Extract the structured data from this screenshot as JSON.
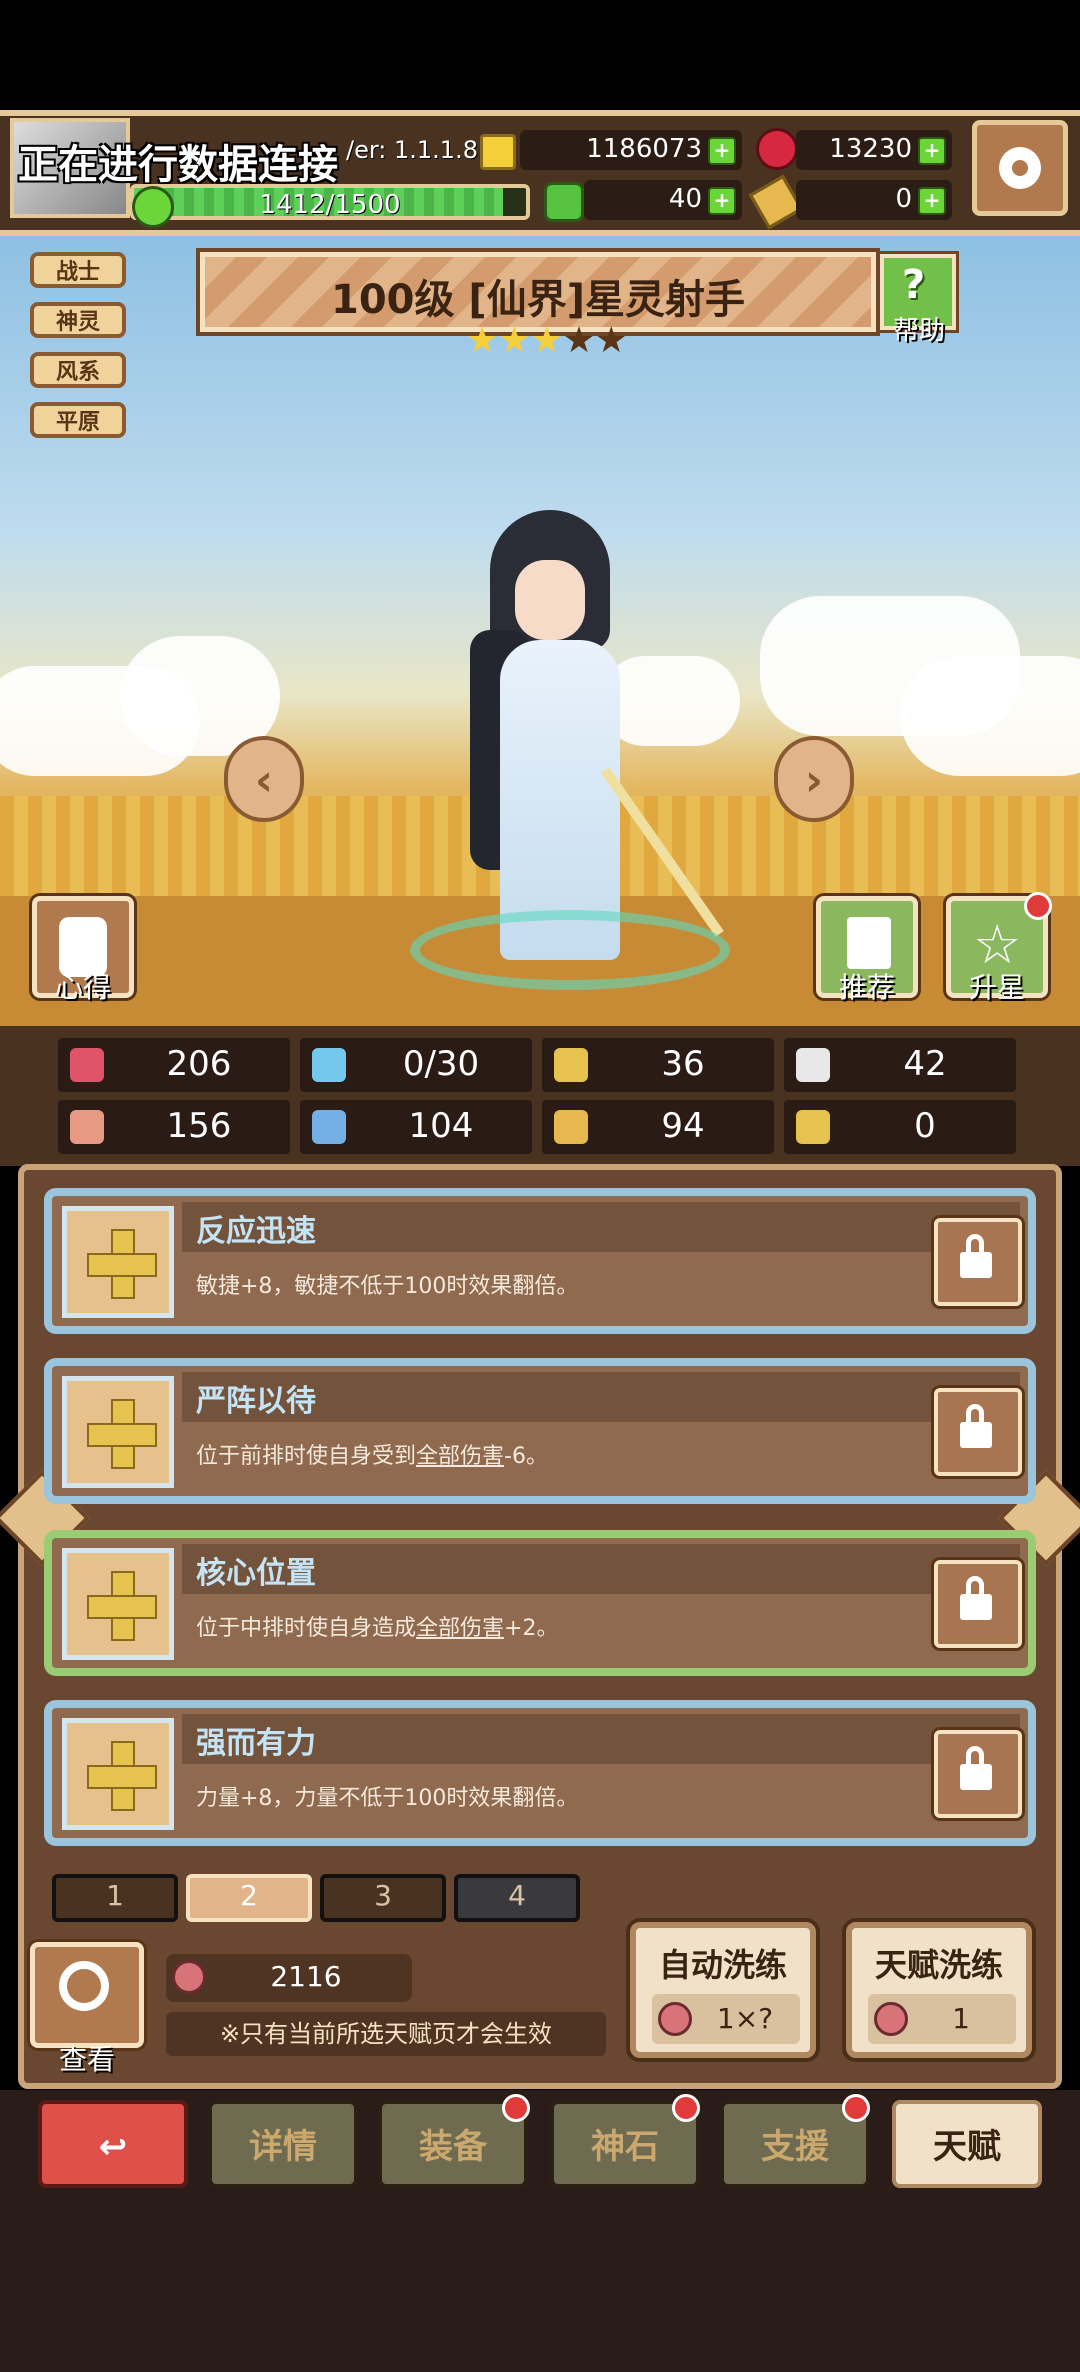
{
  "header": {
    "status_text": "正在进行数据连接",
    "version_text": "/er: 1.1.1.8",
    "exp_text": "1412/1500",
    "exp_progress": 0.941,
    "gold": "1186073",
    "gems": "13230",
    "clover": "40",
    "key_count": "0"
  },
  "hero": {
    "tags": [
      "战士",
      "神灵",
      "风系",
      "平原"
    ],
    "title": "100级 [仙界]星灵射手",
    "stars_filled": 3,
    "stars_total": 5,
    "help_label": "帮助",
    "left_button": "心得",
    "recommend_button": "推荐",
    "star_up_button": "升星"
  },
  "stats": [
    {
      "icon": "heart-icon",
      "value": "206",
      "color": "#e0546a"
    },
    {
      "icon": "water-drop-icon",
      "value": "0/30",
      "color": "#74c8ee"
    },
    {
      "icon": "shield-icon",
      "value": "36",
      "color": "#e6c34f"
    },
    {
      "icon": "wing-icon",
      "value": "42",
      "color": "#e8e8e8"
    },
    {
      "icon": "fist-icon",
      "value": "156",
      "color": "#e69a84"
    },
    {
      "icon": "book-icon",
      "value": "104",
      "color": "#74b0e6"
    },
    {
      "icon": "boot-icon",
      "value": "94",
      "color": "#e6b84f"
    },
    {
      "icon": "horseshoe-icon",
      "value": "0",
      "color": "#e6c34f"
    }
  ],
  "talents": [
    {
      "name": "反应迅速",
      "desc_before": "敏捷+8，敏捷不低于100时效果翻倍。",
      "desc_link": "",
      "desc_after": ""
    },
    {
      "name": "严阵以待",
      "desc_before": "位于前排时使自身受到",
      "desc_link": "全部伤害",
      "desc_after": "-6。"
    },
    {
      "name": "核心位置",
      "desc_before": "位于中排时使自身造成",
      "desc_link": "全部伤害",
      "desc_after": "+2。"
    },
    {
      "name": "强而有力",
      "desc_before": "力量+8，力量不低于100时效果翻倍。",
      "desc_link": "",
      "desc_after": ""
    }
  ],
  "pages": [
    "1",
    "2",
    "3",
    "4"
  ],
  "view_label": "查看",
  "potion_count": "2116",
  "tip": "※只有当前所选天赋页才会生效",
  "auto_refine": {
    "label": "自动洗练",
    "cost": "1×?"
  },
  "talent_refine": {
    "label": "天赋洗练",
    "cost": "1"
  },
  "nav": {
    "back_icon": "return-icon",
    "details": "详情",
    "equipment": "装备",
    "god_stone": "神石",
    "support": "支援",
    "talent": "天赋"
  }
}
